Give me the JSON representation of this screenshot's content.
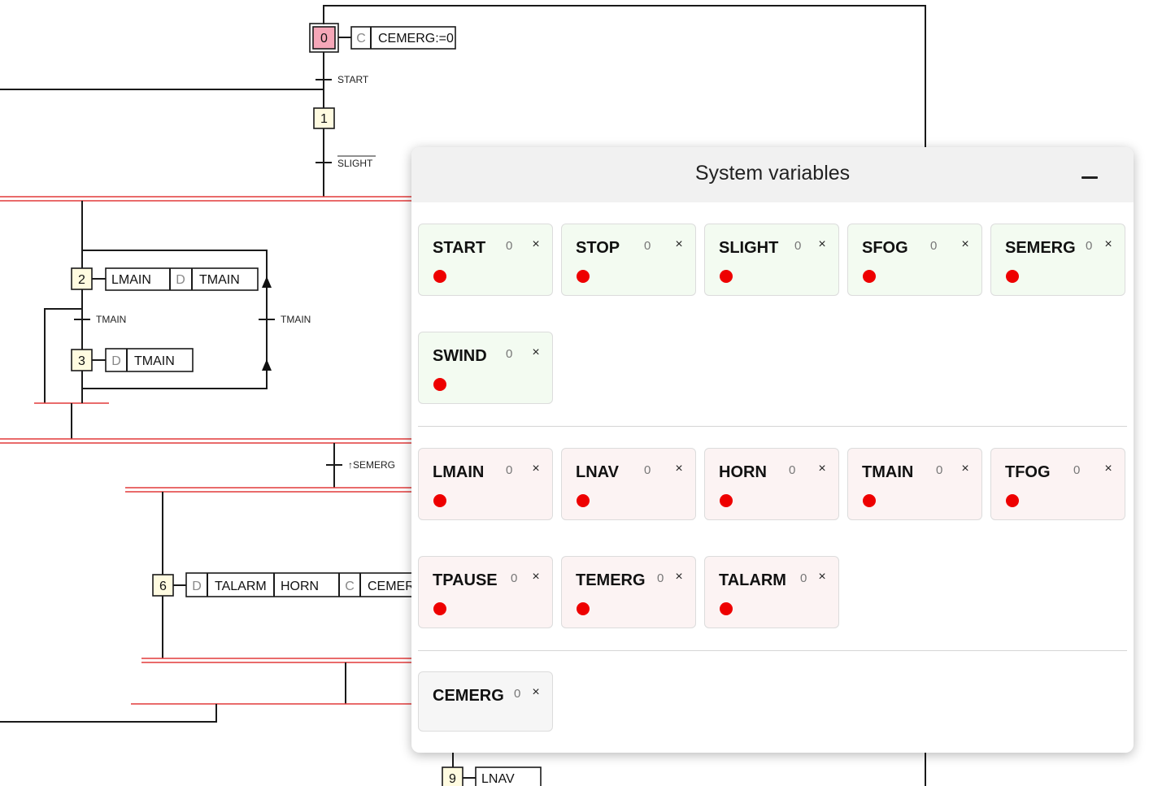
{
  "diagram": {
    "step0": {
      "num": "0",
      "qualifier": "C",
      "action": "CEMERG:=0"
    },
    "t_start": "START",
    "step1": {
      "num": "1"
    },
    "t_slight": "SLIGHT",
    "step2": {
      "num": "2",
      "action1": "LMAIN",
      "qualifier": "D",
      "action2": "TMAIN"
    },
    "t_tmain_left": "TMAIN",
    "t_tmain_right": "TMAIN",
    "step3": {
      "num": "3",
      "qualifier": "D",
      "action": "TMAIN"
    },
    "t_semerg": "↑SEMERG",
    "step6": {
      "num": "6",
      "qualifier1": "D",
      "action1": "TALARM",
      "action2": "HORN",
      "qualifier2": "C",
      "action3": "CEMER"
    },
    "step9": {
      "num": "9",
      "action": "LNAV"
    }
  },
  "panel": {
    "title": "System variables",
    "minimize_icon": "minus-icon",
    "inputs": [
      {
        "name": "START",
        "value": "0",
        "close": "×",
        "state_color": "#ee0000"
      },
      {
        "name": "STOP",
        "value": "0",
        "close": "×",
        "state_color": "#ee0000"
      },
      {
        "name": "SLIGHT",
        "value": "0",
        "close": "×",
        "state_color": "#ee0000"
      },
      {
        "name": "SFOG",
        "value": "0",
        "close": "×",
        "state_color": "#ee0000"
      },
      {
        "name": "SEMERG",
        "value": "0",
        "close": "×",
        "state_color": "#ee0000"
      },
      {
        "name": "SWIND",
        "value": "0",
        "close": "×",
        "state_color": "#ee0000"
      }
    ],
    "outputs": [
      {
        "name": "LMAIN",
        "value": "0",
        "close": "×",
        "state_color": "#ee0000"
      },
      {
        "name": "LNAV",
        "value": "0",
        "close": "×",
        "state_color": "#ee0000"
      },
      {
        "name": "HORN",
        "value": "0",
        "close": "×",
        "state_color": "#ee0000"
      },
      {
        "name": "TMAIN",
        "value": "0",
        "close": "×",
        "state_color": "#ee0000"
      },
      {
        "name": "TFOG",
        "value": "0",
        "close": "×",
        "state_color": "#ee0000"
      },
      {
        "name": "TPAUSE",
        "value": "0",
        "close": "×",
        "state_color": "#ee0000"
      },
      {
        "name": "TEMERG",
        "value": "0",
        "close": "×",
        "state_color": "#ee0000"
      },
      {
        "name": "TALARM",
        "value": "0",
        "close": "×",
        "state_color": "#ee0000"
      }
    ],
    "internals": [
      {
        "name": "CEMERG",
        "value": "0",
        "close": "×"
      }
    ],
    "colors": {
      "input_bg": "#f3fbf1",
      "output_bg": "#fcf3f3",
      "internal_bg": "#f6f6f6",
      "initial_step": "#f5a7b8",
      "step": "#fffbe0",
      "sync_bar": "#e23a3a"
    }
  }
}
